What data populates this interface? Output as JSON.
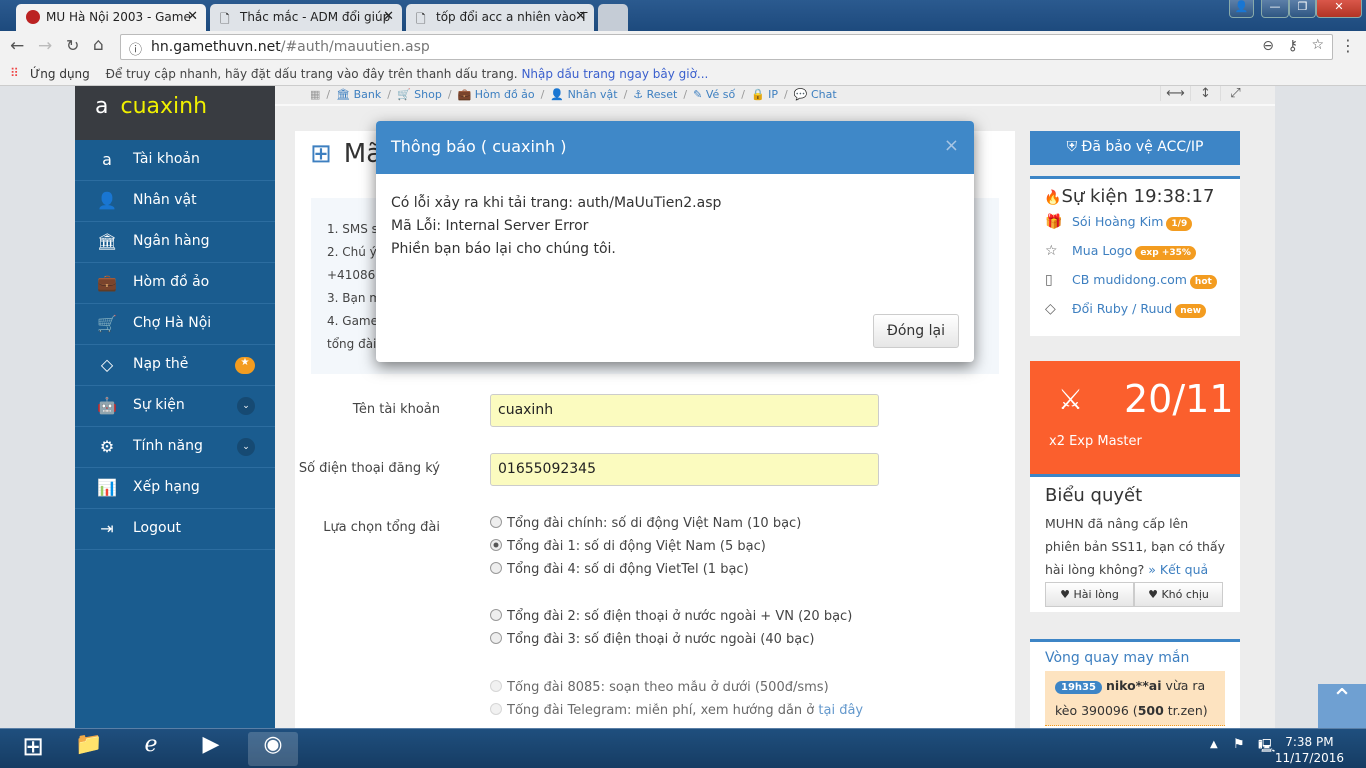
{
  "browser": {
    "tabs": [
      {
        "title": "MU Hà Nội 2003 - Game",
        "active": true
      },
      {
        "title": "Thắc mắc - ADM đổi giúp",
        "active": false
      },
      {
        "title": "tốp đổi acc a nhiên vào T",
        "active": false
      }
    ],
    "url_host": "hn.gamethuvn.net",
    "url_path": "/#auth/mauutien.asp",
    "bookmarks": {
      "apps_label": "Ứng dụng",
      "hint": "Để truy cập nhanh, hãy đặt dấu trang vào đây trên thanh dấu trang.",
      "link": "Nhập dấu trang ngay bây giờ..."
    }
  },
  "sidebar": {
    "username": "cuaxinh",
    "items": [
      {
        "label": "Tài khoản",
        "icon": "amazon-icon"
      },
      {
        "label": "Nhân vật",
        "icon": "user-icon"
      },
      {
        "label": "Ngân hàng",
        "icon": "bank-icon"
      },
      {
        "label": "Hòm đồ ảo",
        "icon": "suitcase-icon"
      },
      {
        "label": "Chợ Hà Nội",
        "icon": "cart-icon"
      },
      {
        "label": "Nạp thẻ",
        "icon": "diamond-icon",
        "badge": "★"
      },
      {
        "label": "Sự kiện",
        "icon": "android-icon",
        "chevron": true
      },
      {
        "label": "Tính năng",
        "icon": "gears-icon",
        "chevron": true
      },
      {
        "label": "Xếp hạng",
        "icon": "bar-chart-icon"
      },
      {
        "label": "Logout",
        "icon": "sign-out-icon"
      }
    ]
  },
  "breadcrumb": [
    "Bank",
    "Shop",
    "Hòm đồ ảo",
    "Nhân vật",
    "Reset",
    "Vé số",
    "IP",
    "Chat"
  ],
  "main": {
    "title": "Mã",
    "info_lines": [
      "1. SMS s",
      "2. Chú ý",
      "+410868",
      "3. Bạn m",
      "4. Game",
      "tổng đài"
    ],
    "form": {
      "account_label": "Tên tài khoản",
      "account_value": "cuaxinh",
      "phone_label": "Số điện thoại đăng ký",
      "phone_value": "01655092345",
      "switchboard_label": "Lựa chọn tổng đài",
      "options": [
        {
          "label": "Tổng đài chính: số di động Việt Nam (10 bạc)",
          "checked": false
        },
        {
          "label": "Tổng đài 1: số di động Việt Nam (5 bạc)",
          "checked": true
        },
        {
          "label": "Tổng đài 4: số di động VietTel (1 bạc)",
          "checked": false
        },
        {
          "label": "Tổng đài 2: số điện thoại ở nước ngoài + VN (20 bạc)",
          "checked": false
        },
        {
          "label": "Tổng đài 3: số điện thoại ở nước ngoài (40 bạc)",
          "checked": false
        },
        {
          "label": "Tổng đài 8085: soạn theo mẫu ở dưới (500đ/sms)",
          "checked": false,
          "disabled": true
        },
        {
          "label": "Tổng đài Telegram: miễn phí, xem hướng dẫn ở ",
          "link": "tại đây",
          "checked": false,
          "disabled": true
        }
      ]
    }
  },
  "right": {
    "protect": "Đã bảo vệ ACC/IP",
    "events_title": "Sự kiện 19:38:17",
    "events": [
      {
        "label": "Sói Hoàng Kim",
        "pill": "1/9"
      },
      {
        "label": "Mua Logo",
        "pill": "exp +35%"
      },
      {
        "label": "CB mudidong.com",
        "pill": "hot"
      },
      {
        "label": "Đổi Ruby / Ruud",
        "pill": "new"
      }
    ],
    "promo": {
      "date": "20/11",
      "text": "x2 Exp Master"
    },
    "poll": {
      "title": "Biểu quyết",
      "question": "MUHN đã nâng cấp lên phiên bản SS11, bạn có thấy hài lòng không?",
      "result_link": "» Kết quả",
      "yes": "Hài lòng",
      "no": "Khó chịu"
    },
    "wheel": {
      "title": "Vòng quay may mắn",
      "time": "19h35",
      "user": "niko**ai",
      "text": " vừa ra kèo 390096 (",
      "amount": "500",
      "unit": " tr.zen)"
    }
  },
  "modal": {
    "title": "Thông báo ( cuaxinh )",
    "lines": [
      "Có lỗi xảy ra khi tải trang: auth/MaUuTien2.asp",
      "Mã Lỗi: Internal Server Error",
      "Phiền bạn báo lại cho chúng tôi."
    ],
    "close_button": "Đóng lại"
  },
  "taskbar": {
    "time": "7:38 PM",
    "date": "11/17/2016"
  },
  "colors": {
    "sidebar": "#1a5c8f",
    "accent": "#3f88c8",
    "promo": "#fb5f2d",
    "badge": "#f39c20",
    "input": "#fbfbbf"
  }
}
